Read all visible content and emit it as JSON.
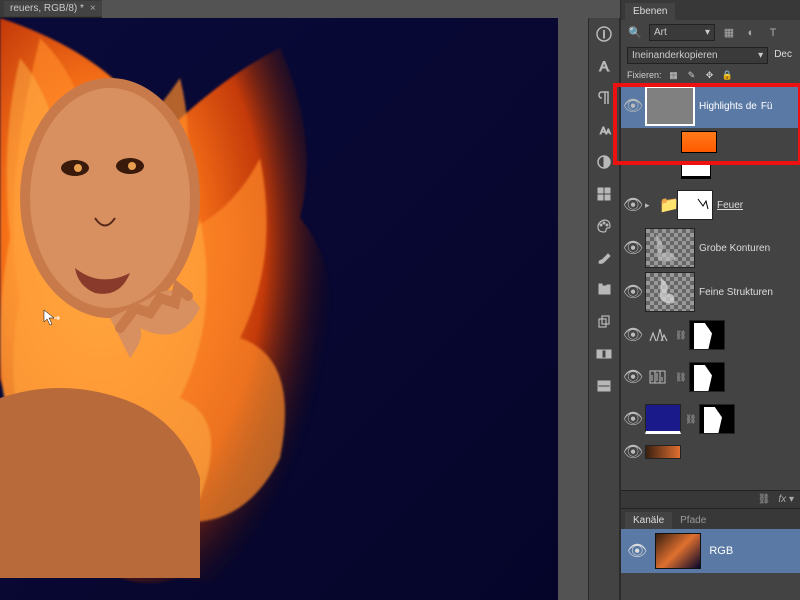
{
  "document": {
    "tab_title": "reuers, RGB/8) *"
  },
  "panels": {
    "layers_tab": "Ebenen",
    "filter_label": "Art",
    "blend_mode": "Ineinanderkopieren",
    "opacity_label": "Dec",
    "lock_label": "Fixieren:",
    "layers": [
      {
        "name": "Highlights de",
        "extra": "Fü"
      },
      {
        "name": ""
      },
      {
        "name": "Feuer"
      },
      {
        "name": "Grobe Konturen"
      },
      {
        "name": "Feine Strukturen"
      },
      {
        "name": ""
      },
      {
        "name": ""
      },
      {
        "name": ""
      },
      {
        "name": ""
      }
    ],
    "footer_fx": "fx"
  },
  "channels": {
    "tab_active": "Kanäle",
    "tab_inactive": "Pfade",
    "rgb": "RGB"
  }
}
